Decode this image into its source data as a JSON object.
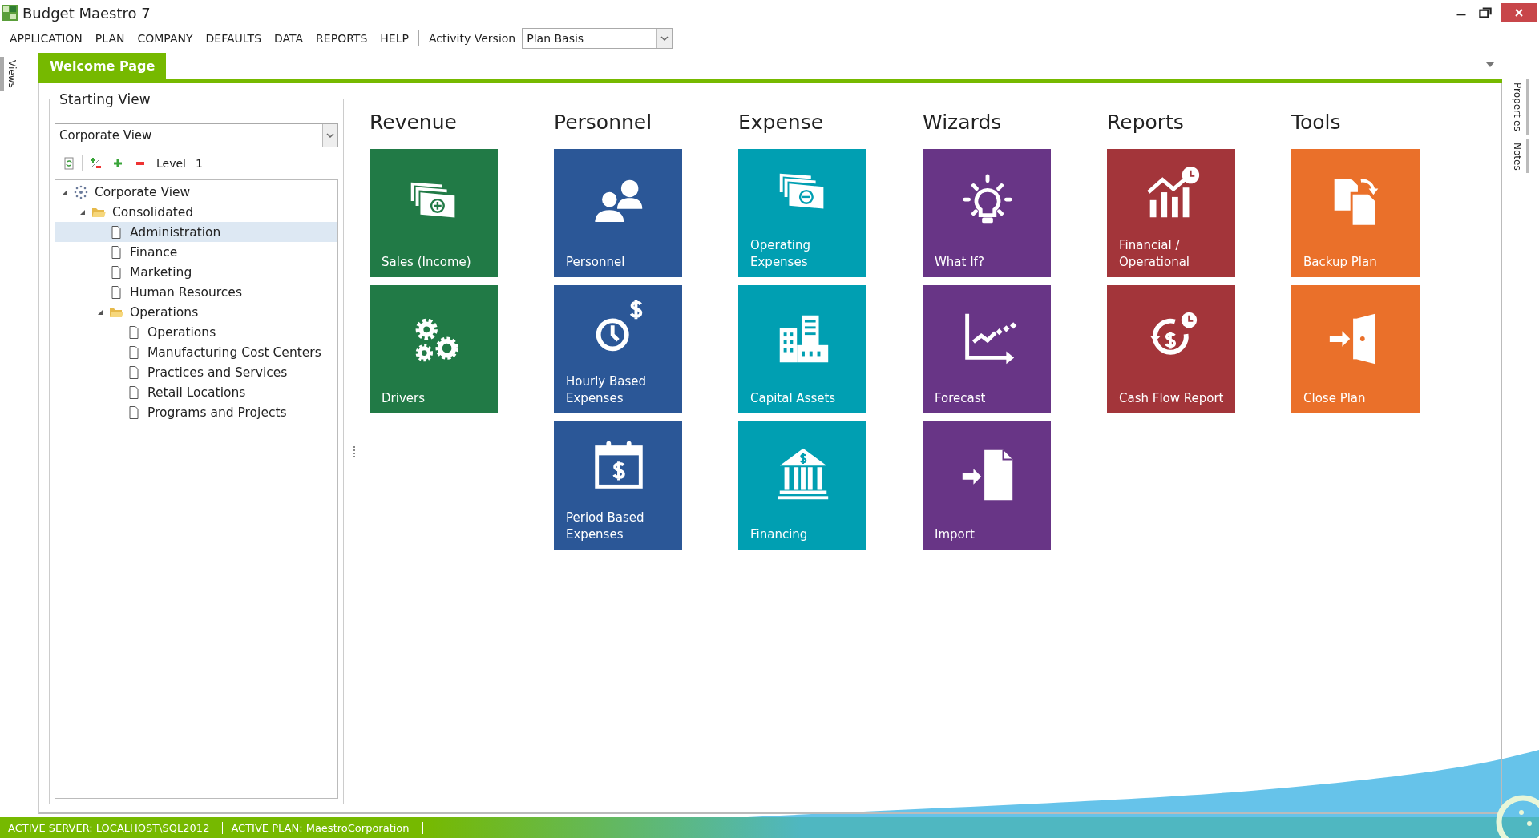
{
  "window": {
    "title": "Budget Maestro 7"
  },
  "menu": [
    "APPLICATION",
    "PLAN",
    "COMPANY",
    "DEFAULTS",
    "DATA",
    "REPORTS",
    "HELP"
  ],
  "activity_version": {
    "label": "Activity Version",
    "value": "Plan Basis"
  },
  "left_strip": {
    "label": "Views"
  },
  "right_strip": [
    "Properties",
    "Notes"
  ],
  "tabs": [
    {
      "label": "Welcome Page",
      "selected": true
    }
  ],
  "starting_view": {
    "title": "Starting View",
    "dropdown": "Corporate View",
    "level_label": "Level",
    "level_value": "1",
    "tree": [
      {
        "label": "Corporate View",
        "kind": "root",
        "expanded": true,
        "selected": false,
        "children": [
          {
            "label": "Consolidated",
            "kind": "folder",
            "expanded": true,
            "selected": false,
            "children": [
              {
                "label": "Administration",
                "kind": "doc",
                "selected": true
              },
              {
                "label": "Finance",
                "kind": "doc",
                "selected": false
              },
              {
                "label": "Marketing",
                "kind": "doc",
                "selected": false
              },
              {
                "label": "Human Resources",
                "kind": "doc",
                "selected": false
              },
              {
                "label": "Operations",
                "kind": "folder",
                "expanded": true,
                "selected": false,
                "children": [
                  {
                    "label": "Operations",
                    "kind": "doc",
                    "selected": false
                  },
                  {
                    "label": "Manufacturing Cost Centers",
                    "kind": "doc",
                    "selected": false
                  },
                  {
                    "label": "Practices and Services",
                    "kind": "doc",
                    "selected": false
                  },
                  {
                    "label": "Retail Locations",
                    "kind": "doc",
                    "selected": false
                  },
                  {
                    "label": "Programs and Projects",
                    "kind": "doc",
                    "selected": false
                  }
                ]
              }
            ]
          }
        ]
      }
    ]
  },
  "groups": [
    {
      "title": "Revenue",
      "tiles": [
        {
          "label": "Sales (Income)",
          "kind": "cash-plus",
          "color": "#217a46"
        },
        {
          "label": "Drivers",
          "kind": "gears",
          "color": "#217a46"
        }
      ]
    },
    {
      "title": "Personnel",
      "tiles": [
        {
          "label": "Personnel",
          "kind": "people",
          "color": "#2b5797"
        },
        {
          "label": "Hourly Based Expenses",
          "kind": "clock-dollar",
          "color": "#2b5797"
        },
        {
          "label": "Period Based Expenses",
          "kind": "calendar-dollar",
          "color": "#2b5797"
        }
      ]
    },
    {
      "title": "Expense",
      "tiles": [
        {
          "label": "Operating Expenses",
          "kind": "cash-minus",
          "color": "#009fb2"
        },
        {
          "label": "Capital Assets",
          "kind": "buildings",
          "color": "#009fb2"
        },
        {
          "label": "Financing",
          "kind": "bank",
          "color": "#009fb2"
        }
      ]
    },
    {
      "title": "Wizards",
      "tiles": [
        {
          "label": "What If?",
          "kind": "bulb",
          "color": "#683586"
        },
        {
          "label": "Forecast",
          "kind": "forecast",
          "color": "#683586"
        },
        {
          "label": "Import",
          "kind": "import",
          "color": "#683586"
        }
      ]
    },
    {
      "title": "Reports",
      "tiles": [
        {
          "label": "Financial / Operational",
          "kind": "chart-clock",
          "color": "#a3353a"
        },
        {
          "label": "Cash Flow Report",
          "kind": "cycle-dollar",
          "color": "#a3353a"
        }
      ]
    },
    {
      "title": "Tools",
      "tiles": [
        {
          "label": "Backup Plan",
          "kind": "backup",
          "color": "#ea702a"
        },
        {
          "label": "Close Plan",
          "kind": "exit",
          "color": "#ea702a"
        }
      ]
    }
  ],
  "status_bar": [
    "ACTIVE SERVER: LOCALHOST\\SQL2012",
    "ACTIVE PLAN: MaestroCorporation"
  ]
}
